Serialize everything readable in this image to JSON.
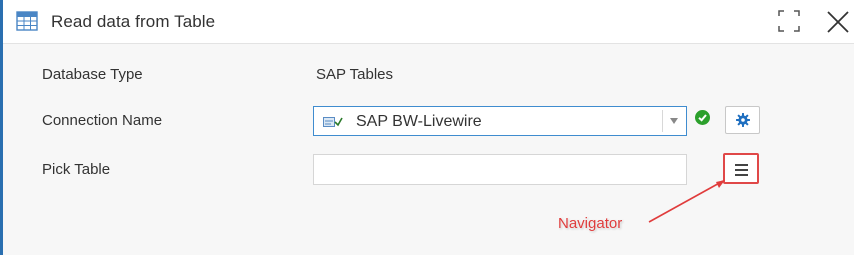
{
  "header": {
    "title": "Read data from Table",
    "icons": {
      "app": "table-icon",
      "maximize": "maximize-icon",
      "close": "close-icon"
    }
  },
  "form": {
    "database_type": {
      "label": "Database Type",
      "value": "SAP Tables"
    },
    "connection_name": {
      "label": "Connection Name",
      "selected": "SAP BW-Livewire",
      "status": "connected",
      "icons": {
        "connection": "connection-check-icon",
        "status": "check-circle-icon",
        "settings": "gear-icon",
        "dropdown": "chevron-down-icon"
      }
    },
    "pick_table": {
      "label": "Pick Table",
      "value": "",
      "placeholder": "",
      "navigator_icon": "hamburger-menu-icon"
    }
  },
  "annotation": {
    "label": "Navigator",
    "color": "#e03c3c"
  },
  "colors": {
    "accent": "#2a6fb0",
    "success": "#2ca02c",
    "gear": "#1f6fc0",
    "highlight": "#e04848"
  }
}
